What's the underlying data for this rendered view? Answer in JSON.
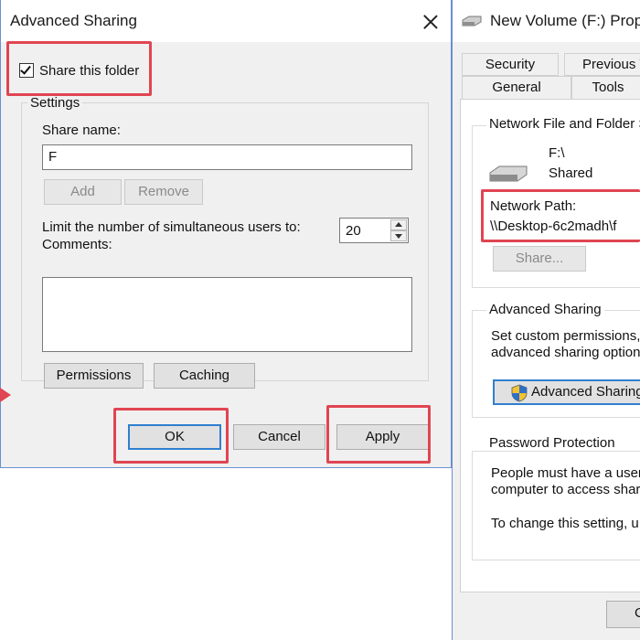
{
  "left_dialog": {
    "title": "Advanced Sharing",
    "share_checkbox": {
      "label": "Share this folder",
      "checked": true
    },
    "settings": {
      "legend": "Settings",
      "share_name_label": "Share name:",
      "share_name_value": "F",
      "add_label": "Add",
      "remove_label": "Remove",
      "limit_label": "Limit the number of simultaneous users to:",
      "limit_value": "20",
      "comments_label": "Comments:",
      "comments_value": "",
      "permissions_label": "Permissions",
      "caching_label": "Caching"
    },
    "ok_label": "OK",
    "cancel_label": "Cancel",
    "apply_label": "Apply"
  },
  "right_dialog": {
    "title": "New Volume (F:) Prope",
    "tabs_row1": [
      "Security",
      "Previous V"
    ],
    "tabs_row2": [
      "General",
      "Tools"
    ],
    "network_sharing": {
      "legend": "Network File and Folder S",
      "drive_name": "F:\\",
      "drive_status": "Shared",
      "network_path_label": "Network Path:",
      "network_path_value": "\\\\Desktop-6c2madh\\f",
      "share_button": "Share..."
    },
    "advanced_sharing": {
      "legend": "Advanced Sharing",
      "desc_line1": "Set custom permissions, c",
      "desc_line2": "advanced sharing option",
      "button_label": "Advanced Sharing"
    },
    "password_protection": {
      "legend": "Password Protection",
      "line1": "People must have a user",
      "line2": "computer to access shar",
      "line3": "To change this setting, u"
    },
    "bottom_button": "C"
  },
  "colors": {
    "highlight": "#e04552",
    "accent": "#2f7fd0",
    "window_border": "#6a8fd3"
  }
}
